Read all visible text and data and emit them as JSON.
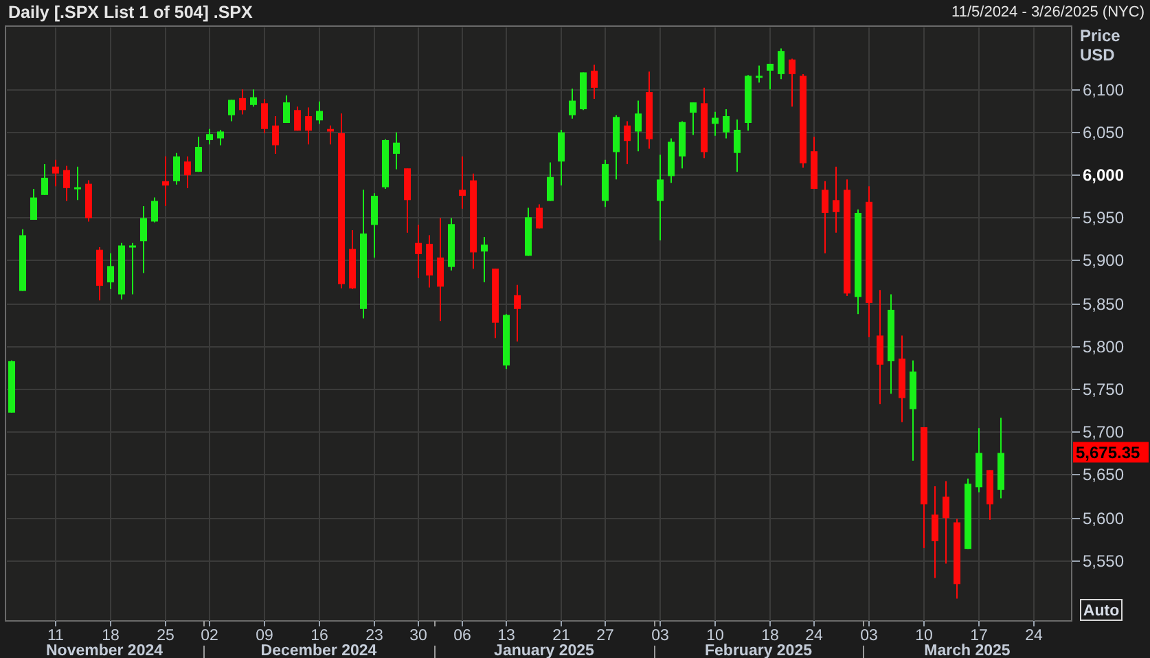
{
  "header": {
    "title": "Daily [.SPX List 1 of 504] .SPX",
    "date_range": "11/5/2024 - 3/26/2025 (NYC)"
  },
  "chart": {
    "currency": "USD",
    "last_price": "5,675.35",
    "auto_button": "Auto",
    "months": [
      {
        "label": "November 2024"
      },
      {
        "label": "December 2024"
      },
      {
        "label": "January 2025"
      },
      {
        "label": "February 2025"
      },
      {
        "label": "March 2025"
      }
    ],
    "chart_data": {
      "type": "candlestick",
      "ylabel": "Price",
      "categories": [
        null,
        null,
        null,
        null,
        "11",
        null,
        null,
        null,
        null,
        "18",
        null,
        null,
        null,
        null,
        "25",
        null,
        null,
        null,
        "02",
        null,
        null,
        null,
        null,
        "09",
        null,
        null,
        null,
        null,
        "16",
        null,
        null,
        null,
        null,
        "23",
        null,
        null,
        null,
        "30",
        null,
        null,
        null,
        "06",
        null,
        null,
        null,
        "13",
        null,
        null,
        null,
        null,
        "21",
        null,
        null,
        null,
        "27",
        null,
        null,
        null,
        null,
        "03",
        null,
        null,
        null,
        null,
        "10",
        null,
        null,
        null,
        null,
        "18",
        null,
        null,
        null,
        "24",
        null,
        null,
        null,
        null,
        "03",
        null,
        null,
        null,
        null,
        "10",
        null,
        null,
        null,
        null,
        "17",
        null,
        null,
        null,
        null,
        "24",
        null,
        null
      ],
      "ohlc": [
        [
          5722,
          5783,
          5722,
          5782
        ],
        [
          5864,
          5936,
          5864,
          5929
        ],
        [
          5947,
          5983,
          5947,
          5973
        ],
        [
          5976,
          6012,
          5976,
          5996
        ],
        [
          6009,
          6017,
          5986,
          6001
        ],
        [
          6005,
          6010,
          5969,
          5984
        ],
        [
          5985,
          6009,
          5970,
          5985
        ],
        [
          5989,
          5993,
          5945,
          5949
        ],
        [
          5912,
          5915,
          5853,
          5870
        ],
        [
          5874,
          5908,
          5866,
          5893
        ],
        [
          5860,
          5920,
          5854,
          5917
        ],
        [
          5917,
          5920,
          5860,
          5917
        ],
        [
          5922,
          5963,
          5885,
          5949
        ],
        [
          5945,
          5973,
          5944,
          5969
        ],
        [
          5992,
          6021,
          5963,
          5987
        ],
        [
          5992,
          6025,
          5988,
          6021
        ],
        [
          6015,
          6021,
          5984,
          5999
        ],
        [
          6003,
          6044,
          6003,
          6032
        ],
        [
          6040,
          6053,
          6035,
          6047
        ],
        [
          6042,
          6052,
          6034,
          6050
        ],
        [
          6069,
          6087,
          6062,
          6087
        ],
        [
          6089,
          6099,
          6070,
          6075
        ],
        [
          6081,
          6099,
          6079,
          6090
        ],
        [
          6083,
          6088,
          6048,
          6053
        ],
        [
          6057,
          6068,
          6024,
          6034
        ],
        [
          6060,
          6092,
          6060,
          6084
        ],
        [
          6075,
          6079,
          6051,
          6051
        ],
        [
          6068,
          6078,
          6035,
          6051
        ],
        [
          6063,
          6085,
          6059,
          6074
        ],
        [
          6053,
          6057,
          6035,
          6050
        ],
        [
          6048,
          6071,
          5867,
          5872
        ],
        [
          5913,
          5935,
          5866,
          5867
        ],
        [
          5843,
          5982,
          5832,
          5931
        ],
        [
          5941,
          5978,
          5903,
          5975
        ],
        [
          5985,
          6041,
          5983,
          6040
        ],
        [
          6024,
          6049,
          6006,
          6037
        ],
        [
          6007,
          6007,
          5932,
          5970
        ],
        [
          5920,
          5941,
          5879,
          5907
        ],
        [
          5919,
          5929,
          5868,
          5882
        ],
        [
          5903,
          5949,
          5829,
          5869
        ],
        [
          5892,
          5949,
          5888,
          5942
        ],
        [
          5982,
          6021,
          5960,
          5975
        ],
        [
          5993,
          6001,
          5890,
          5909
        ],
        [
          5910,
          5927,
          5874,
          5918
        ],
        [
          5890,
          5890,
          5809,
          5827
        ],
        [
          5777,
          5837,
          5773,
          5836
        ],
        [
          5859,
          5871,
          5805,
          5843
        ],
        [
          5905,
          5961,
          5905,
          5950
        ],
        [
          5961,
          5965,
          5937,
          5937
        ],
        [
          5969,
          6014,
          5969,
          5997
        ],
        [
          6015,
          6052,
          5987,
          6049
        ],
        [
          6069,
          6100,
          6065,
          6086
        ],
        [
          6076,
          6119,
          6075,
          6119
        ],
        [
          6121,
          6128,
          6088,
          6101
        ],
        [
          5969,
          6017,
          5962,
          6012
        ],
        [
          6026,
          6069,
          5994,
          6067
        ],
        [
          6057,
          6062,
          6012,
          6039
        ],
        [
          6050,
          6086,
          6027,
          6071
        ],
        [
          6096,
          6120,
          6030,
          6041
        ],
        [
          5969,
          6023,
          5923,
          5994
        ],
        [
          5998,
          6042,
          5990,
          6038
        ],
        [
          6021,
          6062,
          6007,
          6061
        ],
        [
          6072,
          6084,
          6046,
          6084
        ],
        [
          6083,
          6101,
          6019,
          6026
        ],
        [
          6059,
          6073,
          6045,
          6066
        ],
        [
          6049,
          6076,
          6042,
          6068
        ],
        [
          6025,
          6064,
          6003,
          6052
        ],
        [
          6060,
          6116,
          6051,
          6115
        ],
        [
          6115,
          6127,
          6107,
          6115
        ],
        [
          6121,
          6129,
          6099,
          6129
        ],
        [
          6117,
          6147,
          6111,
          6144
        ],
        [
          6134,
          6135,
          6079,
          6117
        ],
        [
          6115,
          6117,
          6008,
          6013
        ],
        [
          6027,
          6044,
          5983,
          5983
        ],
        [
          5982,
          5992,
          5908,
          5955
        ],
        [
          5970,
          6009,
          5932,
          5956
        ],
        [
          5982,
          5994,
          5858,
          5861
        ],
        [
          5857,
          5959,
          5837,
          5955
        ],
        [
          5968,
          5986,
          5810,
          5850
        ],
        [
          5812,
          5865,
          5732,
          5778
        ],
        [
          5782,
          5860,
          5744,
          5842
        ],
        [
          5785,
          5812,
          5711,
          5739
        ],
        [
          5726,
          5783,
          5666,
          5770
        ],
        [
          5705,
          5705,
          5564,
          5615
        ],
        [
          5603,
          5636,
          5529,
          5572
        ],
        [
          5624,
          5642,
          5546,
          5599
        ],
        [
          5594,
          5598,
          5505,
          5522
        ],
        [
          5563,
          5645,
          5563,
          5639
        ],
        [
          5635,
          5704,
          5629,
          5675
        ],
        [
          5655,
          5655,
          5597,
          5615
        ],
        [
          5632,
          5716,
          5622,
          5675
        ],
        null,
        null,
        null,
        null,
        null
      ],
      "grid": true,
      "ylim": [
        5479,
        6173
      ],
      "yticks": [
        {
          "value": 5550,
          "label": "5,550"
        },
        {
          "value": 5600,
          "label": "5,600"
        },
        {
          "value": 5650,
          "label": "5,650"
        },
        {
          "value": 5700,
          "label": "5,700"
        },
        {
          "value": 5750,
          "label": "5,750"
        },
        {
          "value": 5800,
          "label": "5,800"
        },
        {
          "value": 5850,
          "label": "5,850"
        },
        {
          "value": 5900,
          "label": "5,900"
        },
        {
          "value": 5950,
          "label": "5,950"
        },
        {
          "value": 6000,
          "label": "6,000"
        },
        {
          "value": 6050,
          "label": "6,050"
        },
        {
          "value": 6100,
          "label": "6,100"
        }
      ]
    }
  }
}
